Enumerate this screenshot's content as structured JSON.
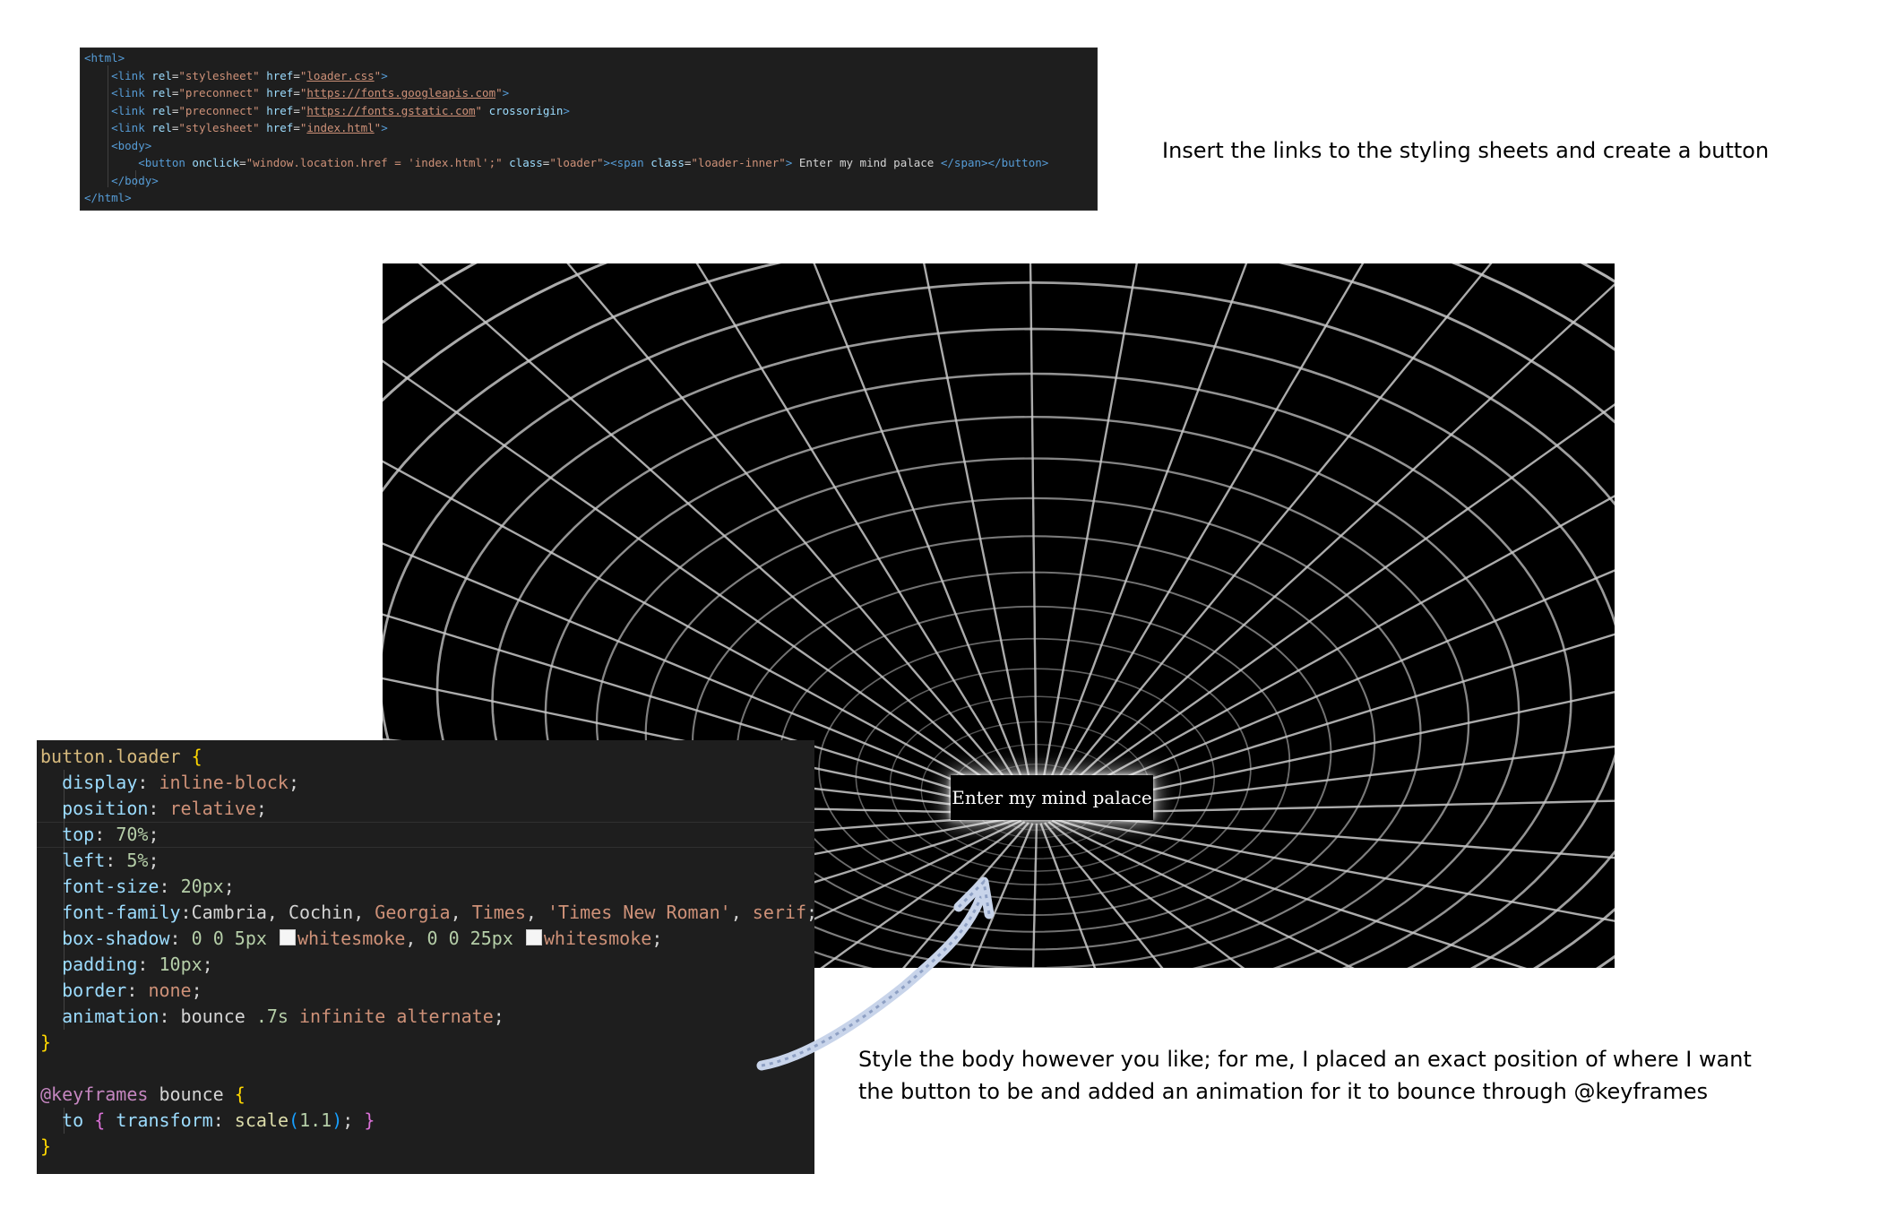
{
  "html_snippet": {
    "lines": [
      [
        [
          "tag",
          "<html>"
        ]
      ],
      [
        [
          "tag",
          "    <link "
        ],
        [
          "attr",
          "rel"
        ],
        [
          "plain",
          "="
        ],
        [
          "str",
          "\"stylesheet\""
        ],
        [
          "plain",
          " "
        ],
        [
          "attr",
          "href"
        ],
        [
          "plain",
          "="
        ],
        [
          "str",
          "\""
        ],
        [
          "link",
          "loader.css"
        ],
        [
          "str",
          "\""
        ],
        [
          "tag",
          ">"
        ]
      ],
      [
        [
          "tag",
          "    <link "
        ],
        [
          "attr",
          "rel"
        ],
        [
          "plain",
          "="
        ],
        [
          "str",
          "\"preconnect\""
        ],
        [
          "plain",
          " "
        ],
        [
          "attr",
          "href"
        ],
        [
          "plain",
          "="
        ],
        [
          "str",
          "\""
        ],
        [
          "link",
          "https://fonts.googleapis.com"
        ],
        [
          "str",
          "\""
        ],
        [
          "tag",
          ">"
        ]
      ],
      [
        [
          "tag",
          "    <link "
        ],
        [
          "attr",
          "rel"
        ],
        [
          "plain",
          "="
        ],
        [
          "str",
          "\"preconnect\""
        ],
        [
          "plain",
          " "
        ],
        [
          "attr",
          "href"
        ],
        [
          "plain",
          "="
        ],
        [
          "str",
          "\""
        ],
        [
          "link",
          "https://fonts.gstatic.com"
        ],
        [
          "str",
          "\""
        ],
        [
          "plain",
          " "
        ],
        [
          "attr",
          "crossorigin"
        ],
        [
          "tag",
          ">"
        ]
      ],
      [
        [
          "tag",
          "    <link "
        ],
        [
          "attr",
          "rel"
        ],
        [
          "plain",
          "="
        ],
        [
          "str",
          "\"stylesheet\""
        ],
        [
          "plain",
          " "
        ],
        [
          "attr",
          "href"
        ],
        [
          "plain",
          "="
        ],
        [
          "str",
          "\""
        ],
        [
          "link",
          "index.html"
        ],
        [
          "str",
          "\""
        ],
        [
          "tag",
          ">"
        ]
      ],
      [
        [
          "tag",
          "    <body>"
        ]
      ],
      [
        [
          "tag",
          "        <button "
        ],
        [
          "attr",
          "onclick"
        ],
        [
          "plain",
          "="
        ],
        [
          "str",
          "\"window.location.href = 'index.html';\""
        ],
        [
          "plain",
          " "
        ],
        [
          "attr",
          "class"
        ],
        [
          "plain",
          "="
        ],
        [
          "str",
          "\"loader\""
        ],
        [
          "tag",
          "><span "
        ],
        [
          "attr",
          "class"
        ],
        [
          "plain",
          "="
        ],
        [
          "str",
          "\"loader-inner\""
        ],
        [
          "tag",
          ">"
        ],
        [
          "plain",
          " Enter my mind palace "
        ],
        [
          "tag",
          "</span></button>"
        ]
      ],
      [
        [
          "tag",
          "    </body>"
        ]
      ],
      [
        [
          "tag",
          "</html>"
        ]
      ]
    ]
  },
  "notes": {
    "top": "Insert the links to the styling sheets and create a button",
    "bottom_line1": "Style the body however you like; for me, I placed an exact position of where I want",
    "bottom_line2": "the button to be and added an animation for it to bounce through @keyframes"
  },
  "preview": {
    "button_label": "Enter my mind palace"
  },
  "css_snippet": {
    "lines": [
      [
        [
          "sel",
          "button.loader "
        ],
        [
          "brace",
          "{"
        ]
      ],
      [
        [
          "plain",
          "  "
        ],
        [
          "prop",
          "display"
        ],
        [
          "plain",
          ": "
        ],
        [
          "val",
          "inline-block"
        ],
        [
          "plain",
          ";"
        ]
      ],
      [
        [
          "plain",
          "  "
        ],
        [
          "prop",
          "position"
        ],
        [
          "plain",
          ": "
        ],
        [
          "val",
          "relative"
        ],
        [
          "plain",
          ";"
        ]
      ],
      [
        [
          "plain",
          "  "
        ],
        [
          "prop",
          "top"
        ],
        [
          "plain",
          ": "
        ],
        [
          "num",
          "70%"
        ],
        [
          "plain",
          ";"
        ]
      ],
      [
        [
          "plain",
          "  "
        ],
        [
          "prop",
          "left"
        ],
        [
          "plain",
          ": "
        ],
        [
          "num",
          "5%"
        ],
        [
          "plain",
          ";"
        ]
      ],
      [
        [
          "plain",
          "  "
        ],
        [
          "prop",
          "font-size"
        ],
        [
          "plain",
          ": "
        ],
        [
          "num",
          "20px"
        ],
        [
          "plain",
          ";"
        ]
      ],
      [
        [
          "plain",
          "  "
        ],
        [
          "prop",
          "font-family"
        ],
        [
          "plain",
          ":Cambria, Cochin, "
        ],
        [
          "val",
          "Georgia"
        ],
        [
          "plain",
          ", "
        ],
        [
          "val",
          "Times"
        ],
        [
          "plain",
          ", "
        ],
        [
          "val",
          "'Times New Roman'"
        ],
        [
          "plain",
          ", "
        ],
        [
          "val",
          "serif"
        ],
        [
          "plain",
          ";"
        ]
      ],
      [
        [
          "plain",
          "  "
        ],
        [
          "prop",
          "box-shadow"
        ],
        [
          "plain",
          ": "
        ],
        [
          "num",
          "0"
        ],
        [
          "plain",
          " "
        ],
        [
          "num",
          "0"
        ],
        [
          "plain",
          " "
        ],
        [
          "num",
          "5px"
        ],
        [
          "plain",
          " "
        ],
        [
          "swatch",
          ""
        ],
        [
          "val",
          "whitesmoke"
        ],
        [
          "plain",
          ", "
        ],
        [
          "num",
          "0"
        ],
        [
          "plain",
          " "
        ],
        [
          "num",
          "0"
        ],
        [
          "plain",
          " "
        ],
        [
          "num",
          "25px"
        ],
        [
          "plain",
          " "
        ],
        [
          "swatch",
          ""
        ],
        [
          "val",
          "whitesmoke"
        ],
        [
          "plain",
          ";"
        ]
      ],
      [
        [
          "plain",
          "  "
        ],
        [
          "prop",
          "padding"
        ],
        [
          "plain",
          ": "
        ],
        [
          "num",
          "10px"
        ],
        [
          "plain",
          ";"
        ]
      ],
      [
        [
          "plain",
          "  "
        ],
        [
          "prop",
          "border"
        ],
        [
          "plain",
          ": "
        ],
        [
          "val",
          "none"
        ],
        [
          "plain",
          ";"
        ]
      ],
      [
        [
          "plain",
          "  "
        ],
        [
          "prop",
          "animation"
        ],
        [
          "plain",
          ": bounce "
        ],
        [
          "num",
          ".7s"
        ],
        [
          "plain",
          " "
        ],
        [
          "val",
          "infinite alternate"
        ],
        [
          "plain",
          ";"
        ]
      ],
      [
        [
          "brace",
          "}"
        ]
      ],
      [
        [
          "plain",
          ""
        ]
      ],
      [
        [
          "at",
          "@keyframes"
        ],
        [
          "plain",
          " bounce "
        ],
        [
          "brace",
          "{"
        ]
      ],
      [
        [
          "plain",
          "  "
        ],
        [
          "prop",
          "to"
        ],
        [
          "plain",
          " "
        ],
        [
          "brace2",
          "{"
        ],
        [
          "plain",
          " "
        ],
        [
          "prop",
          "transform"
        ],
        [
          "plain",
          ": "
        ],
        [
          "fn",
          "scale"
        ],
        [
          "paren",
          "("
        ],
        [
          "num",
          "1.1"
        ],
        [
          "paren",
          ")"
        ],
        [
          "plain",
          "; "
        ],
        [
          "brace2",
          "}"
        ]
      ],
      [
        [
          "brace",
          "}"
        ]
      ]
    ]
  }
}
